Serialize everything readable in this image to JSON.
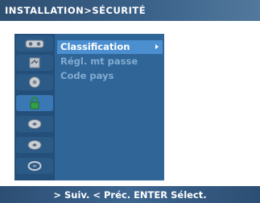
{
  "header": {
    "title": "INSTALLATION>SÉCURITÉ"
  },
  "menu": {
    "items": [
      {
        "label": "Classification",
        "selected": true
      },
      {
        "label": "Régl. mt passe",
        "selected": false
      },
      {
        "label": "Code pays",
        "selected": false
      }
    ]
  },
  "sidebar": {
    "icons": [
      "picture-icon",
      "sound-icon",
      "channel-icon",
      "lock-icon",
      "disc-icon",
      "disc-icon",
      "setup-disc-icon"
    ]
  },
  "footer": {
    "hint": "> Suiv.  < Préc.  ENTER Sélect."
  },
  "colors": {
    "accent": "#4b8fd0",
    "panel": "#2f6597",
    "dim_text": "#82acd2"
  }
}
